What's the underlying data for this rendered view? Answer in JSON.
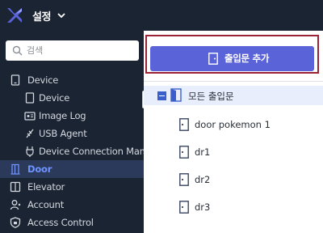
{
  "header": {
    "title": "설정",
    "logo_color": "#5b63d9"
  },
  "sidebar": {
    "search": {
      "placeholder": "검색",
      "value": ""
    },
    "items": [
      {
        "label": "Device",
        "icon": "tablet-icon"
      },
      {
        "label": "Device",
        "icon": "device-icon"
      },
      {
        "label": "Image Log",
        "icon": "image-log-icon"
      },
      {
        "label": "USB Agent",
        "icon": "usb-icon"
      },
      {
        "label": "Device Connection Man",
        "icon": "connection-icon"
      },
      {
        "label": "Door",
        "icon": "door-icon",
        "selected": true
      },
      {
        "label": "Elevator",
        "icon": "elevator-icon"
      },
      {
        "label": "Account",
        "icon": "user-icon"
      },
      {
        "label": "Access Control",
        "icon": "shield-icon"
      }
    ]
  },
  "main": {
    "add_button_label": "출입문 추가",
    "tree": {
      "root_label": "모든 출입문",
      "doors": [
        "door pokemon 1",
        "dr1",
        "dr2",
        "dr3"
      ]
    }
  },
  "colors": {
    "sidebar_bg": "#1b2433",
    "accent": "#5b63d9",
    "highlight_border": "#9b2335",
    "selected_text": "#6f93ff"
  }
}
